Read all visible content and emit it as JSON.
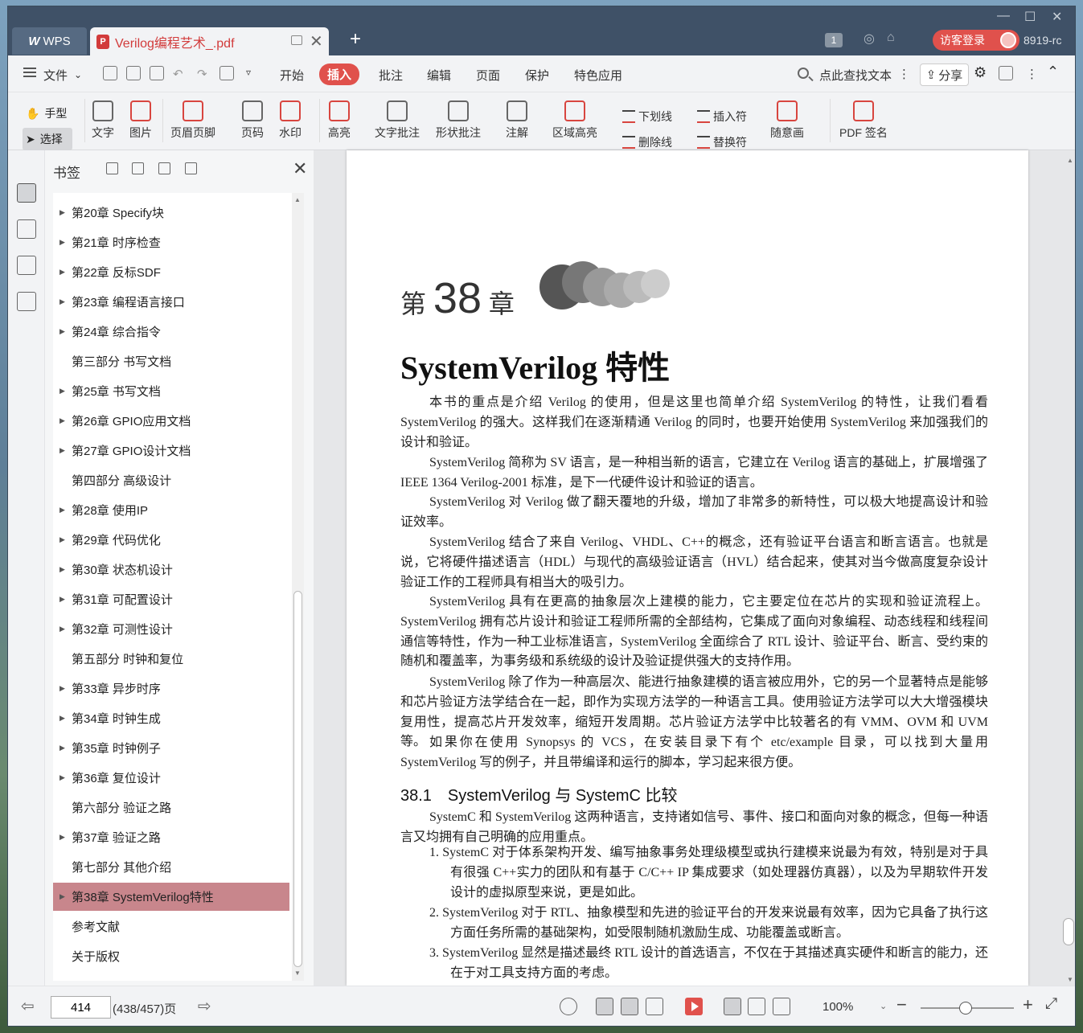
{
  "titlebar": {
    "wps_tab": "WPS",
    "doc_tab": "Verilog编程艺术_.pdf",
    "login_label": "访客登录",
    "user_id": "8919-rc"
  },
  "menu": {
    "file": "文件",
    "tabs": [
      "开始",
      "插入",
      "批注",
      "编辑",
      "页面",
      "保护",
      "特色应用"
    ],
    "active_tab": "插入",
    "search_placeholder": "点此查找文本",
    "share": "分享"
  },
  "toolbar": {
    "hand": "手型",
    "select": "选择",
    "text": "文字",
    "image": "图片",
    "header_footer": "页眉页脚",
    "page_num": "页码",
    "watermark": "水印",
    "highlight": "高亮",
    "text_comment": "文字批注",
    "shape_comment": "形状批注",
    "note": "注解",
    "area_highlight": "区域高亮",
    "underline": "下划线",
    "strikethrough": "删除线",
    "insert_mark": "插入符",
    "replace_mark": "替换符",
    "freehand": "随意画",
    "pdf_sign": "PDF 签名"
  },
  "bookmarks": {
    "title": "书签",
    "items": [
      {
        "label": "第20章 Specify块",
        "expandable": true
      },
      {
        "label": "第21章 时序检查",
        "expandable": true
      },
      {
        "label": "第22章 反标SDF",
        "expandable": true
      },
      {
        "label": "第23章 编程语言接口",
        "expandable": true
      },
      {
        "label": "第24章 综合指令",
        "expandable": true
      },
      {
        "label": "第三部分 书写文档",
        "expandable": false
      },
      {
        "label": "第25章 书写文档",
        "expandable": true
      },
      {
        "label": "第26章 GPIO应用文档",
        "expandable": true
      },
      {
        "label": "第27章 GPIO设计文档",
        "expandable": true
      },
      {
        "label": "第四部分 高级设计",
        "expandable": false
      },
      {
        "label": "第28章 使用IP",
        "expandable": true
      },
      {
        "label": "第29章 代码优化",
        "expandable": true
      },
      {
        "label": "第30章 状态机设计",
        "expandable": true
      },
      {
        "label": "第31章 可配置设计",
        "expandable": true
      },
      {
        "label": "第32章 可测性设计",
        "expandable": true
      },
      {
        "label": "第五部分 时钟和复位",
        "expandable": false
      },
      {
        "label": "第33章 异步时序",
        "expandable": true
      },
      {
        "label": "第34章 时钟生成",
        "expandable": true
      },
      {
        "label": "第35章 时钟例子",
        "expandable": true
      },
      {
        "label": "第36章 复位设计",
        "expandable": true
      },
      {
        "label": "第六部分 验证之路",
        "expandable": false
      },
      {
        "label": "第37章 验证之路",
        "expandable": true
      },
      {
        "label": "第七部分 其他介绍",
        "expandable": false
      },
      {
        "label": "第38章 SystemVerilog特性",
        "expandable": true,
        "selected": true
      },
      {
        "label": "参考文献",
        "expandable": false
      },
      {
        "label": "关于版权",
        "expandable": false
      }
    ]
  },
  "document": {
    "chapter_prefix": "第",
    "chapter_num": "38",
    "chapter_suffix": "章",
    "title": "SystemVerilog 特性",
    "paragraphs": [
      "本书的重点是介绍 Verilog 的使用，但是这里也简单介绍 SystemVerilog 的特性，让我们看看 SystemVerilog 的强大。这样我们在逐渐精通 Verilog 的同时，也要开始使用 SystemVerilog 来加强我们的设计和验证。",
      "SystemVerilog 简称为 SV 语言，是一种相当新的语言，它建立在 Verilog 语言的基础上，扩展增强了 IEEE 1364 Verilog-2001 标准，是下一代硬件设计和验证的语言。",
      "SystemVerilog 对 Verilog 做了翻天覆地的升级，增加了非常多的新特性，可以极大地提高设计和验证效率。",
      "SystemVerilog 结合了来自 Verilog、VHDL、C++的概念，还有验证平台语言和断言语言。也就是说，它将硬件描述语言（HDL）与现代的高级验证语言（HVL）结合起来，使其对当今做高度复杂设计验证工作的工程师具有相当大的吸引力。",
      "SystemVerilog 具有在更高的抽象层次上建模的能力，它主要定位在芯片的实现和验证流程上。SystemVerilog 拥有芯片设计和验证工程师所需的全部结构，它集成了面向对象编程、动态线程和线程间通信等特性，作为一种工业标准语言，SystemVerilog 全面综合了 RTL 设计、验证平台、断言、受约束的随机和覆盖率，为事务级和系统级的设计及验证提供强大的支持作用。",
      "SystemVerilog 除了作为一种高层次、能进行抽象建模的语言被应用外，它的另一个显著特点是能够和芯片验证方法学结合在一起，即作为实现方法学的一种语言工具。使用验证方法学可以大大增强模块复用性，提高芯片开发效率，缩短开发周期。芯片验证方法学中比较著名的有 VMM、OVM 和 UVM 等。",
      "如果你在使用 Synopsys 的 VCS，在安装目录下有个 etc/example 目录，可以找到大量用 SystemVerilog 写的例子，并且带编译和运行的脚本，学习起来很方便。"
    ],
    "section_heading": "38.1　SystemVerilog 与 SystemC 比较",
    "section_intro": "SystemC 和 SystemVerilog 这两种语言，支持诸如信号、事件、接口和面向对象的概念，但每一种语言又均拥有自己明确的应用重点。",
    "list_items": [
      "1.  SystemC 对于体系架构开发、编写抽象事务处理级模型或执行建模来说最为有效，特别是对于具有很强 C++实力的团队和有基于 C/C++ IP 集成要求（如处理器仿真器），以及为早期软件开发设计的虚拟原型来说，更是如此。",
      "2.  SystemVerilog 对于 RTL、抽象模型和先进的验证平台的开发来说最有效率，因为它具备了执行这方面任务所需的基础架构，如受限制随机激励生成、功能覆盖或断言。",
      "3.  SystemVerilog 显然是描述最终 RTL 设计的首选语言，不仅在于其描述真实硬件和断言的能力，还在于对工具支持方面的考虑。"
    ]
  },
  "status": {
    "page_input": "414",
    "page_count": "(438/457)页",
    "zoom": "100%"
  },
  "colors": {
    "accent": "#e0514c",
    "titlebar": "#3f5167",
    "bookmark_selected": "#c8868c"
  }
}
